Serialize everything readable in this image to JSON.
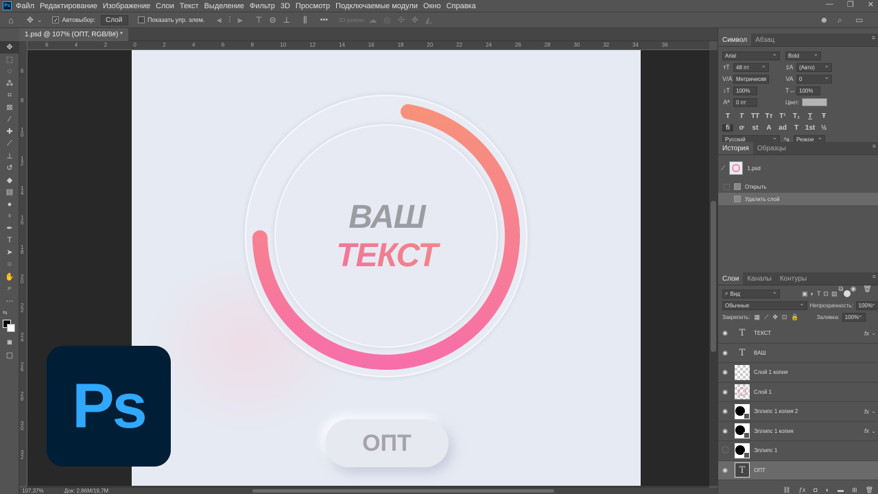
{
  "menubar": {
    "app_icon_label": "Ps",
    "items": [
      "Файл",
      "Редактирование",
      "Изображение",
      "Слои",
      "Текст",
      "Выделение",
      "Фильтр",
      "3D",
      "Просмотр",
      "Подключаемые модули",
      "Окно",
      "Справка"
    ],
    "window_buttons": [
      "—",
      "❐",
      "✕"
    ]
  },
  "options": {
    "autoselect_label": "Автовыбор:",
    "autoselect_value": "Слой",
    "show_controls_label": "Показать упр. элем.",
    "mode3d_label": "3D-режим:",
    "more": "•••"
  },
  "document": {
    "tab_title": "1.psd @ 107% (ОПТ, RGB/8#) *",
    "zoom": "107,37%",
    "doc_size": "Док: 2,86M/19,7M"
  },
  "rulers": {
    "top": [
      "6",
      "4",
      "2",
      "0",
      "2",
      "4",
      "6",
      "8",
      "10",
      "12",
      "14",
      "16",
      "18",
      "20",
      "22",
      "24",
      "26",
      "28",
      "30",
      "32",
      "34",
      "36"
    ],
    "left": [
      "6",
      "8",
      "1\n0",
      "1\n2",
      "1\n4",
      "1\n6",
      "1\n8",
      "2\n0",
      "2\n2",
      "2\n4",
      "2\n6",
      "2\n8",
      "3\n0",
      "3\n2"
    ]
  },
  "canvas": {
    "line1": "ВАШ",
    "line2": "ТЕКСТ",
    "button": "ОПТ",
    "progress_fraction": 0.72,
    "colors": {
      "bg": "#e6eaf3",
      "grad_start": "#f7917a",
      "grad_end": "#f76fa8",
      "text_grey": "#9c9ca3"
    }
  },
  "character_panel": {
    "tabs": [
      "Символ",
      "Абзац"
    ],
    "font_family": "Arial",
    "font_style": "Bold",
    "size": "48 пт",
    "leading": "(Авто)",
    "kerning": "Метрически",
    "tracking": "0",
    "vscale": "100%",
    "hscale": "100%",
    "baseline": "0 пт",
    "color_label": "Цвет:",
    "type_buttons": [
      "T",
      "T",
      "TT",
      "Tт",
      "T¹",
      "T₁",
      "T",
      "Ŧ"
    ],
    "ot_buttons": [
      "fi",
      "ơ",
      "st",
      "A",
      "ad",
      "T",
      "1st",
      "½"
    ],
    "language": "Русский",
    "antialias": "Резкое"
  },
  "history_panel": {
    "tabs": [
      "История",
      "Образцы"
    ],
    "snapshot": "1.psd",
    "items": [
      "Открыть",
      "Удалить слой"
    ]
  },
  "layers_panel": {
    "tabs": [
      "Слои",
      "Каналы",
      "Контуры"
    ],
    "filter": "Вид",
    "blend_mode": "Обычные",
    "opacity_label": "Непрозрачность:",
    "opacity": "100%",
    "lock_label": "Закрепить:",
    "fill_label": "Заливка:",
    "fill": "100%",
    "layers": [
      {
        "name": "ТЕКСТ",
        "kind": "text",
        "fx": "fx"
      },
      {
        "name": "ВАШ",
        "kind": "text",
        "fx": ""
      },
      {
        "name": "Слой 1 копия",
        "kind": "checker",
        "fx": ""
      },
      {
        "name": "Слой 1",
        "kind": "checker",
        "fx": ""
      },
      {
        "name": "Эллипс 1 копия 2",
        "kind": "shape",
        "fx": "fx"
      },
      {
        "name": "Эллипс 1 копия",
        "kind": "shape",
        "fx": "fx"
      },
      {
        "name": "Эллипс 1",
        "kind": "shape",
        "fx": ""
      },
      {
        "name": "ОПТ",
        "kind": "text",
        "fx": ""
      }
    ]
  },
  "logo": {
    "label": "Ps"
  }
}
